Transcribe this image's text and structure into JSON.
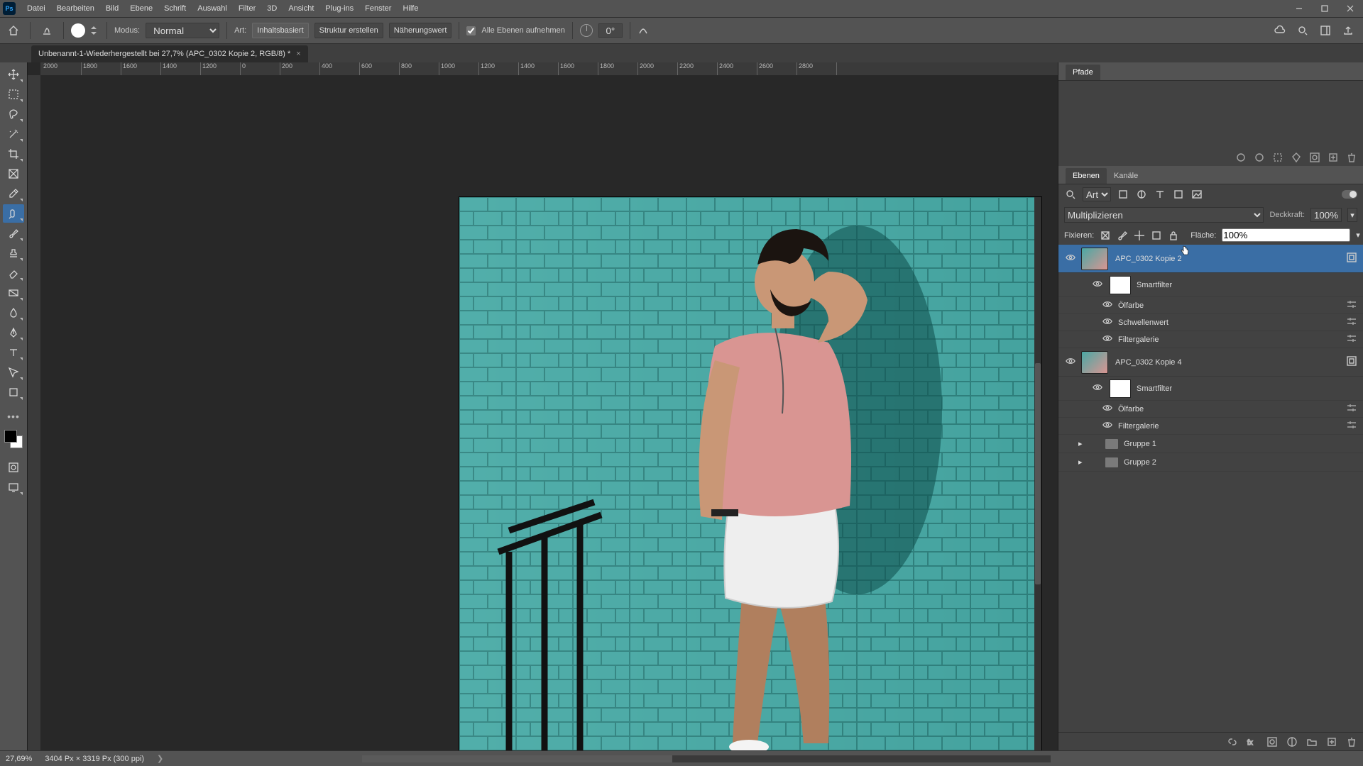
{
  "menu": [
    "Datei",
    "Bearbeiten",
    "Bild",
    "Ebene",
    "Schrift",
    "Auswahl",
    "Filter",
    "3D",
    "Ansicht",
    "Plug-ins",
    "Fenster",
    "Hilfe"
  ],
  "optbar": {
    "modus_label": "Modus:",
    "modus_value": "Normal",
    "art_label": "Art:",
    "art_opts": [
      "Inhaltsbasiert",
      "Struktur erstellen",
      "Näherungswert"
    ],
    "sample_all": "Alle Ebenen aufnehmen",
    "angle": "0°"
  },
  "doc_tab": {
    "title": "Unbenannt-1-Wiederhergestellt bei 27,7% (APC_0302 Kopie 2, RGB/8) *"
  },
  "ruler_ticks": [
    "2000",
    "1800",
    "1600",
    "1400",
    "1200",
    "0",
    "200",
    "400",
    "600",
    "800",
    "1000",
    "1200",
    "1400",
    "1600",
    "1800",
    "2000",
    "2200",
    "2400",
    "2600",
    "2800"
  ],
  "panels": {
    "pfade": "Pfade",
    "ebenen": "Ebenen",
    "kanaele": "Kanäle",
    "art_filter": "Art",
    "blend_mode": "Multiplizieren",
    "deckkraft_label": "Deckkraft:",
    "deckkraft_value": "100%",
    "fixieren_label": "Fixieren:",
    "flaeche_label": "Fläche:",
    "flaeche_value": "100%"
  },
  "layers": [
    {
      "kind": "layer",
      "name": "APC_0302 Kopie 2",
      "selected": true,
      "fx": true
    },
    {
      "kind": "smart",
      "name": "Smartfilter"
    },
    {
      "kind": "filter",
      "name": "Ölfarbe"
    },
    {
      "kind": "filter",
      "name": "Schwellenwert"
    },
    {
      "kind": "filter",
      "name": "Filtergalerie"
    },
    {
      "kind": "layer",
      "name": "APC_0302 Kopie 4",
      "selected": false,
      "fx": true
    },
    {
      "kind": "smart",
      "name": "Smartfilter"
    },
    {
      "kind": "filter",
      "name": "Ölfarbe"
    },
    {
      "kind": "filter",
      "name": "Filtergalerie"
    },
    {
      "kind": "group",
      "name": "Gruppe 1"
    },
    {
      "kind": "group",
      "name": "Gruppe 2"
    }
  ],
  "status": {
    "zoom": "27,69%",
    "dims": "3404 Px × 3319 Px (300 ppi)"
  },
  "colors": {
    "accent": "#3a6ea5",
    "teal": "#4aa8a4",
    "shirt": "#d99592",
    "shorts": "#eeeeee",
    "skin": "#c99776"
  }
}
